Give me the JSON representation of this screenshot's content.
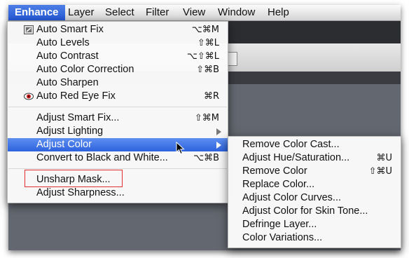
{
  "menubar": {
    "items": [
      "Enhance",
      "Layer",
      "Select",
      "Filter",
      "View",
      "Window",
      "Help"
    ],
    "active": "Enhance"
  },
  "enhance_menu": {
    "items": [
      {
        "label": "Auto Smart Fix",
        "shortcut": "⌥⌘M",
        "icon": "auto-smart-fix-icon"
      },
      {
        "label": "Auto Levels",
        "shortcut": "⇧⌘L"
      },
      {
        "label": "Auto Contrast",
        "shortcut": "⌥⇧⌘L"
      },
      {
        "label": "Auto Color Correction",
        "shortcut": "⇧⌘B"
      },
      {
        "label": "Auto Sharpen",
        "shortcut": ""
      },
      {
        "label": "Auto Red Eye Fix",
        "shortcut": "⌘R",
        "icon": "red-eye-icon"
      },
      {
        "label": "Adjust Smart Fix...",
        "shortcut": "⇧⌘M"
      },
      {
        "label": "Adjust Lighting",
        "submenu": true
      },
      {
        "label": "Adjust Color",
        "submenu": true,
        "highlighted": true
      },
      {
        "label": "Convert to Black and White...",
        "shortcut": "⌥⌘B"
      },
      {
        "label": "Unsharp Mask...",
        "shortcut": "",
        "annotated": true
      },
      {
        "label": "Adjust Sharpness...",
        "shortcut": ""
      }
    ]
  },
  "adjust_color_submenu": {
    "items": [
      {
        "label": "Remove Color Cast...",
        "shortcut": ""
      },
      {
        "label": "Adjust Hue/Saturation...",
        "shortcut": "⌘U"
      },
      {
        "label": "Remove Color",
        "shortcut": "⇧⌘U"
      },
      {
        "label": "Replace Color...",
        "shortcut": ""
      },
      {
        "label": "Adjust Color Curves...",
        "shortcut": ""
      },
      {
        "label": "Adjust Color for Skin Tone...",
        "shortcut": ""
      },
      {
        "label": "Defringe Layer...",
        "shortcut": ""
      },
      {
        "label": "Color Variations...",
        "shortcut": ""
      }
    ]
  },
  "colors": {
    "highlight": "#2d62de",
    "annotation": "#e03030",
    "menubar_active": "#2458d6"
  }
}
